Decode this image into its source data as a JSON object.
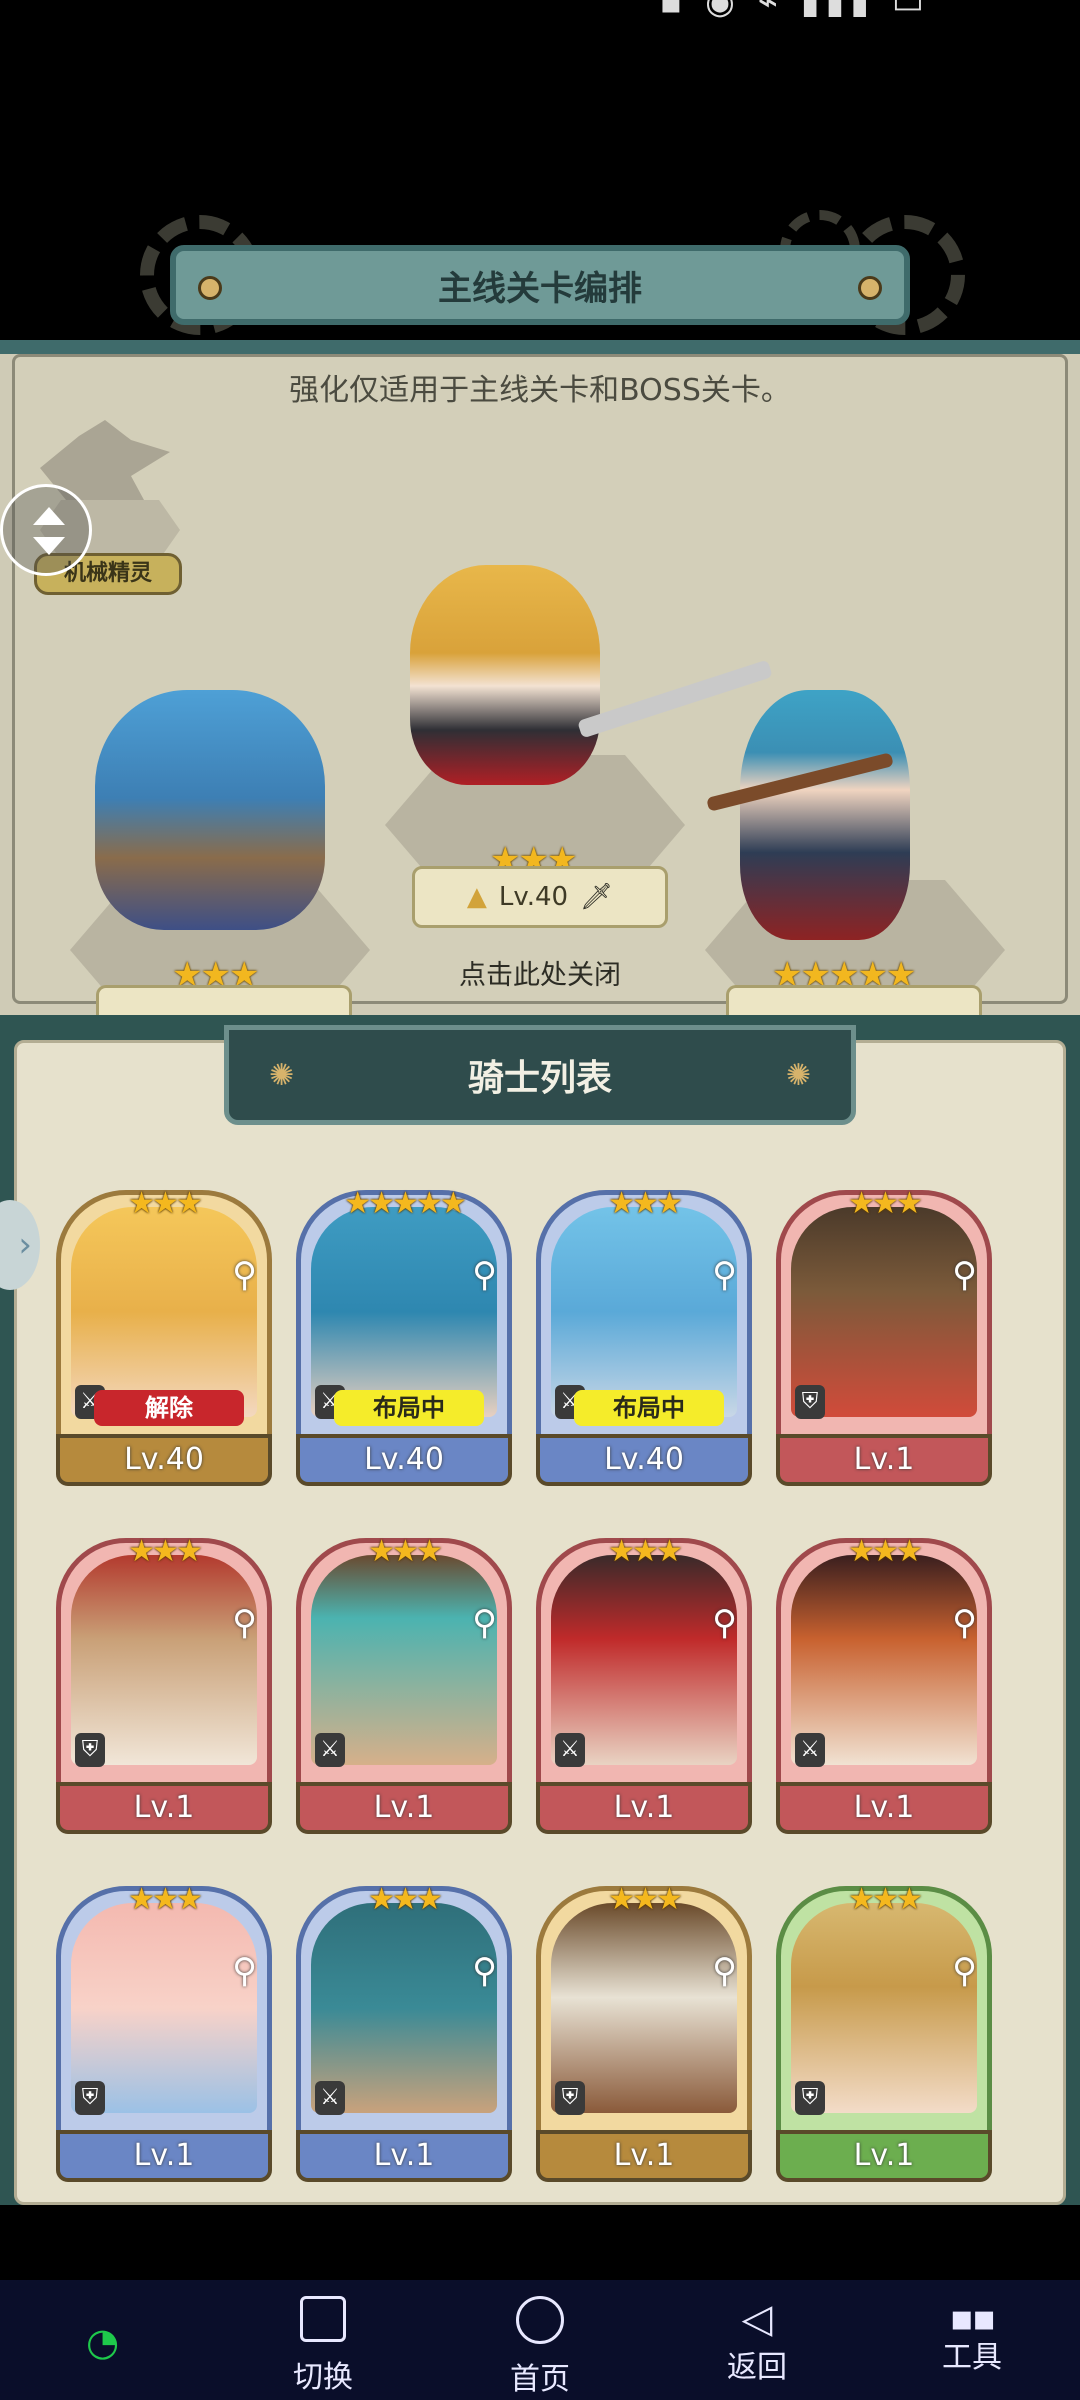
{
  "formation_panel": {
    "title": "主线关卡编排",
    "note": "强化仅适用于主线关卡和BOSS关卡。",
    "mech_label": "机械精灵",
    "close_hint": "点击此处关闭",
    "center_unit": {
      "stars": "★★★",
      "level": "Lv.40"
    },
    "left_unit": {
      "stars": "★★★"
    },
    "right_unit": {
      "stars": "★★★★★"
    }
  },
  "knight_list": {
    "title": "骑士列表",
    "cards": [
      {
        "stars": "★★★",
        "level": "Lv.40",
        "tag": "解除",
        "frame": "gold"
      },
      {
        "stars": "★★★★★",
        "level": "Lv.40",
        "tag": "布局中",
        "frame": "blue"
      },
      {
        "stars": "★★★",
        "level": "Lv.40",
        "tag": "布局中",
        "frame": "blue"
      },
      {
        "stars": "★★★",
        "level": "Lv.1",
        "tag": "",
        "frame": "red"
      },
      {
        "stars": "★★★",
        "level": "Lv.1",
        "tag": "",
        "frame": "red"
      },
      {
        "stars": "★★★",
        "level": "Lv.1",
        "tag": "",
        "frame": "red"
      },
      {
        "stars": "★★★",
        "level": "Lv.1",
        "tag": "",
        "frame": "red"
      },
      {
        "stars": "★★★",
        "level": "Lv.1",
        "tag": "",
        "frame": "red"
      },
      {
        "stars": "★★★",
        "level": "Lv.1",
        "tag": "",
        "frame": "blue"
      },
      {
        "stars": "★★★",
        "level": "Lv.1",
        "tag": "",
        "frame": "blue"
      },
      {
        "stars": "★★★",
        "level": "Lv.1",
        "tag": "",
        "frame": "gold"
      },
      {
        "stars": "★★★",
        "level": "Lv.1",
        "tag": "",
        "frame": "green"
      }
    ]
  },
  "navbar": {
    "switch_label": "切换",
    "home_label": "首页",
    "back_label": "返回",
    "tools_label": "工具"
  },
  "icons": {
    "zoom": "magnifier-icon",
    "class_sword": "sword-icon",
    "class_shield": "shield-icon"
  }
}
